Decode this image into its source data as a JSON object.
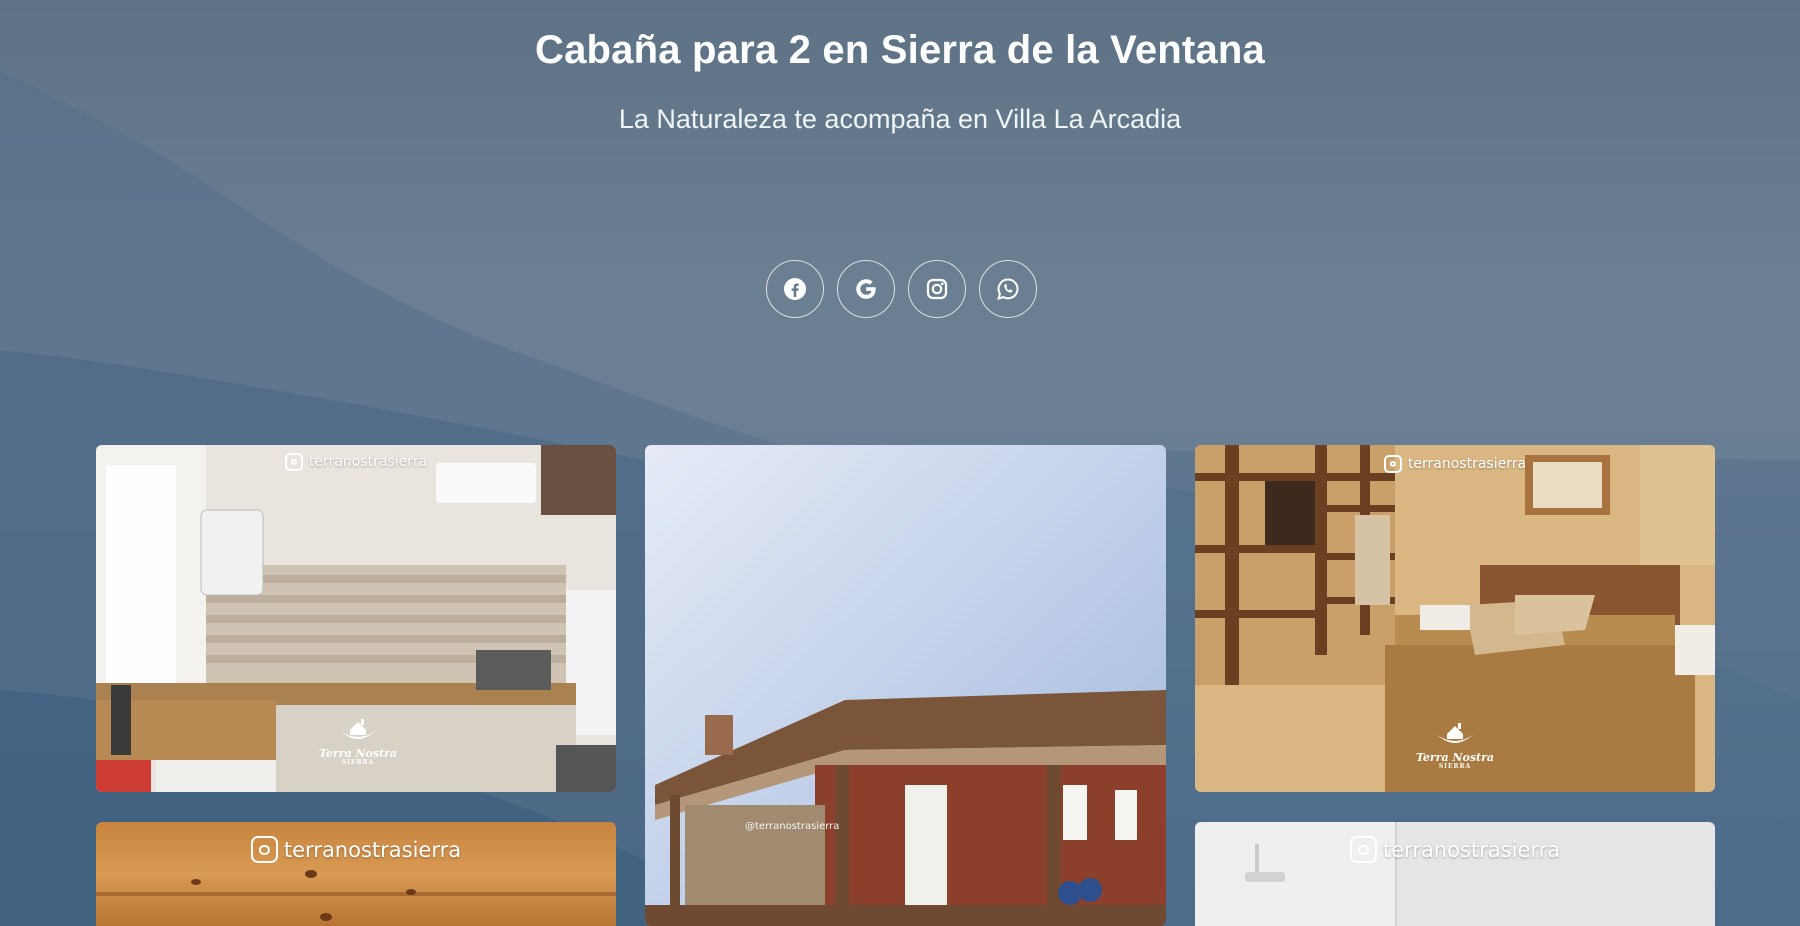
{
  "hero": {
    "title": "Cabaña para 2 en Sierra de la Ventana",
    "subtitle": "La Naturaleza te acompaña en Villa La Arcadia"
  },
  "social": [
    {
      "name": "facebook",
      "icon": "facebook-icon"
    },
    {
      "name": "google",
      "icon": "google-icon"
    },
    {
      "name": "instagram",
      "icon": "instagram-icon"
    },
    {
      "name": "whatsapp",
      "icon": "whatsapp-icon"
    }
  ],
  "gallery": {
    "handle": "terranostrasierra",
    "watermark_handle": "@terranostrasierra",
    "logo_name": "Terra Nostra",
    "logo_sub": "SIERRA",
    "photos": [
      {
        "subject": "kitchen"
      },
      {
        "subject": "cabin exterior"
      },
      {
        "subject": "bedroom"
      },
      {
        "subject": "wood ceiling"
      },
      {
        "subject": "bathroom"
      }
    ]
  },
  "colors": {
    "background_top": "#5e7286",
    "background_bottom": "#3f6583",
    "text": "#ffffff"
  }
}
